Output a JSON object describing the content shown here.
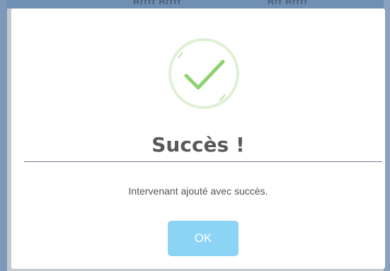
{
  "backdrop": {
    "ghost_left": "Rrrrr Rrrrr",
    "ghost_right": "Rrr Rrrrr"
  },
  "dialog": {
    "icon": "checkmark-success-icon",
    "title": "Succès !",
    "message": "Intervenant ajouté avec succès.",
    "ok_label": "OK"
  },
  "colors": {
    "check_stroke": "#8fd16f",
    "circle_ring": "#dff0d5",
    "button_bg": "#8cd4f5",
    "title_text": "#595959"
  }
}
